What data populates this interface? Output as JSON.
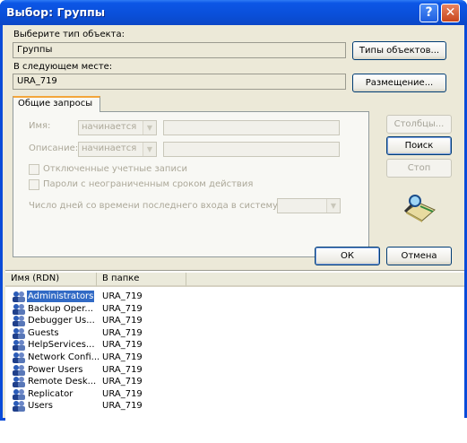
{
  "window": {
    "title": "Выбор: Группы"
  },
  "object_type": {
    "label": "Выберите тип объекта:",
    "value": "Группы",
    "button": "Типы объектов..."
  },
  "location": {
    "label": "В следующем месте:",
    "value": "URA_719",
    "button": "Размещение..."
  },
  "tab": {
    "label": "Общие запросы",
    "name_label": "Имя:",
    "name_op": "начинается",
    "desc_label": "Описание:",
    "desc_op": "начинается",
    "disabled_accounts": "Отключенные учетные записи",
    "no_expire_pwd": "Пароли с неограниченным сроком действия",
    "days_since_login": "Число дней со времени последнего входа в систему:"
  },
  "side_buttons": {
    "columns": "Столбцы...",
    "find": "Поиск",
    "stop": "Стоп"
  },
  "ok": "ОК",
  "cancel": "Отмена",
  "results": {
    "headers": [
      "Имя (RDN)",
      "В папке"
    ],
    "rows": [
      {
        "name": "Administrators",
        "folder": "URA_719"
      },
      {
        "name": "Backup Oper...",
        "folder": "URA_719"
      },
      {
        "name": "Debugger Us...",
        "folder": "URA_719"
      },
      {
        "name": "Guests",
        "folder": "URA_719"
      },
      {
        "name": "HelpServices...",
        "folder": "URA_719"
      },
      {
        "name": "Network Confi...",
        "folder": "URA_719"
      },
      {
        "name": "Power Users",
        "folder": "URA_719"
      },
      {
        "name": "Remote Desk...",
        "folder": "URA_719"
      },
      {
        "name": "Replicator",
        "folder": "URA_719"
      },
      {
        "name": "Users",
        "folder": "URA_719"
      }
    ]
  }
}
